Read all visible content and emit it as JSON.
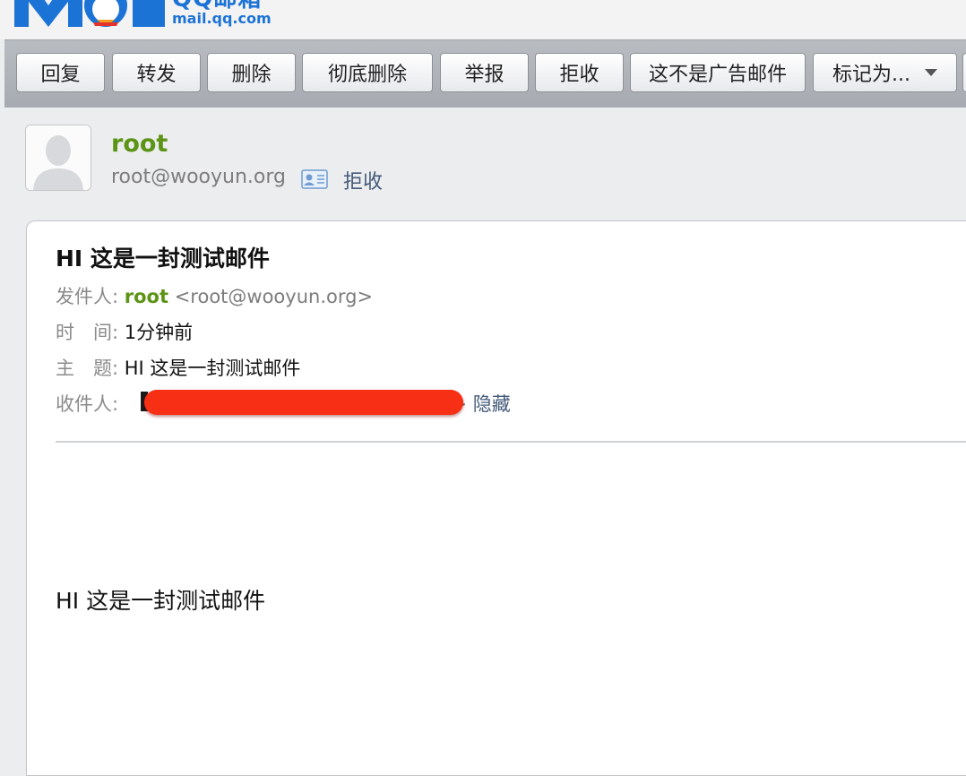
{
  "header": {
    "logo_name": "QQ邮箱",
    "logo_domain": "mail.qq.com"
  },
  "toolbar": {
    "reply": "回复",
    "forward": "转发",
    "delete": "删除",
    "delete_forever": "彻底删除",
    "report": "举报",
    "reject": "拒收",
    "not_spam": "这不是广告邮件",
    "mark_as": "标记为..."
  },
  "sender": {
    "name": "root",
    "email": "root@wooyun.org",
    "reject_label": "拒收"
  },
  "message": {
    "subject": "HI 这是一封测试邮件",
    "from_label": "发件人:",
    "from_name": "root",
    "from_address": "<root@wooyun.org>",
    "time_label": "时　间:",
    "time_value": "1分钟前",
    "subject_label": "主　题:",
    "subject_value": "HI 这是一封测试邮件",
    "to_label": "收件人:",
    "to_close": ">",
    "hide_label": "隐藏",
    "body": "HI 这是一封测试邮件"
  },
  "colors": {
    "brand_blue": "#1c73d6",
    "sender_green": "#5c9416",
    "link_blue": "#435a7a",
    "redaction_red": "#f72f14"
  }
}
